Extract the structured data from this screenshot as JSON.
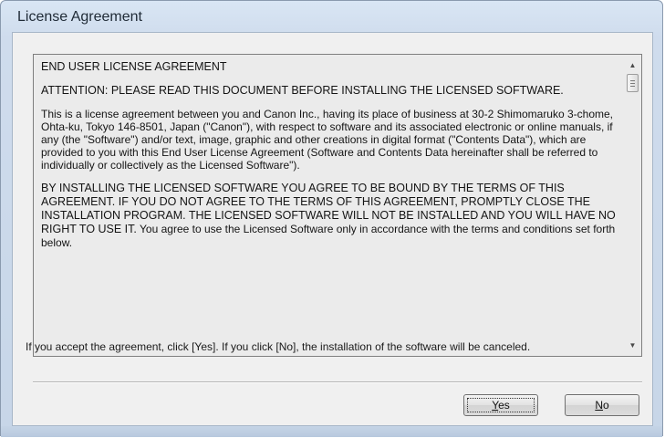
{
  "window": {
    "title": "License Agreement"
  },
  "license": {
    "heading": "END USER LICENSE AGREEMENT",
    "attention": "ATTENTION: PLEASE READ THIS DOCUMENT BEFORE INSTALLING THE LICENSED SOFTWARE.",
    "paragraph1": "This is a license agreement between you and Canon Inc., having its place of business at 30-2 Shimomaruko 3-chome, Ohta-ku, Tokyo 146-8501, Japan (\"Canon\"), with respect to software and its associated electronic or online manuals, if any (the \"Software\") and/or text, image, graphic and other creations in digital format (\"Contents Data\"), which are provided to you with this End User License Agreement (Software and Contents Data hereinafter shall be referred to individually or collectively as the Licensed Software\").",
    "paragraph2_caps": "BY INSTALLING THE LICENSED SOFTWARE YOU AGREE TO BE BOUND BY THE TERMS OF THIS AGREEMENT.  IF YOU DO NOT AGREE TO THE TERMS OF THIS AGREEMENT, PROMPTLY CLOSE THE INSTALLATION PROGRAM.  THE LICENSED SOFTWARE WILL NOT BE INSTALLED AND YOU WILL HAVE NO RIGHT TO USE IT.",
    "paragraph2_tail": "You agree to use the Licensed Software only in accordance with the terms and conditions set forth below."
  },
  "notice": "If you accept the agreement, click [Yes]. If you click [No], the installation of the software will be canceled.",
  "buttons": {
    "yes_mnemonic": "Y",
    "yes_rest": "es",
    "no_mnemonic": "N",
    "no_rest": "o"
  },
  "icons": {
    "scroll_up": "up-arrow-icon",
    "scroll_down": "down-arrow-icon",
    "thumb_grip": "grip-icon"
  }
}
